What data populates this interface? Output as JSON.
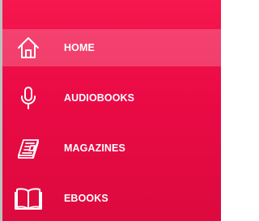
{
  "theme": {
    "accent": "#ea0a45",
    "active_highlight": "#ff4f78",
    "text": "#ffffff"
  },
  "nav": {
    "items": [
      {
        "label": "HOME",
        "icon": "home-icon",
        "active": true
      },
      {
        "label": "AUDIOBOOKS",
        "icon": "microphone-icon",
        "active": false
      },
      {
        "label": "MAGAZINES",
        "icon": "magazine-icon",
        "active": false
      },
      {
        "label": "EBOOKS",
        "icon": "open-book-icon",
        "active": false
      }
    ]
  }
}
